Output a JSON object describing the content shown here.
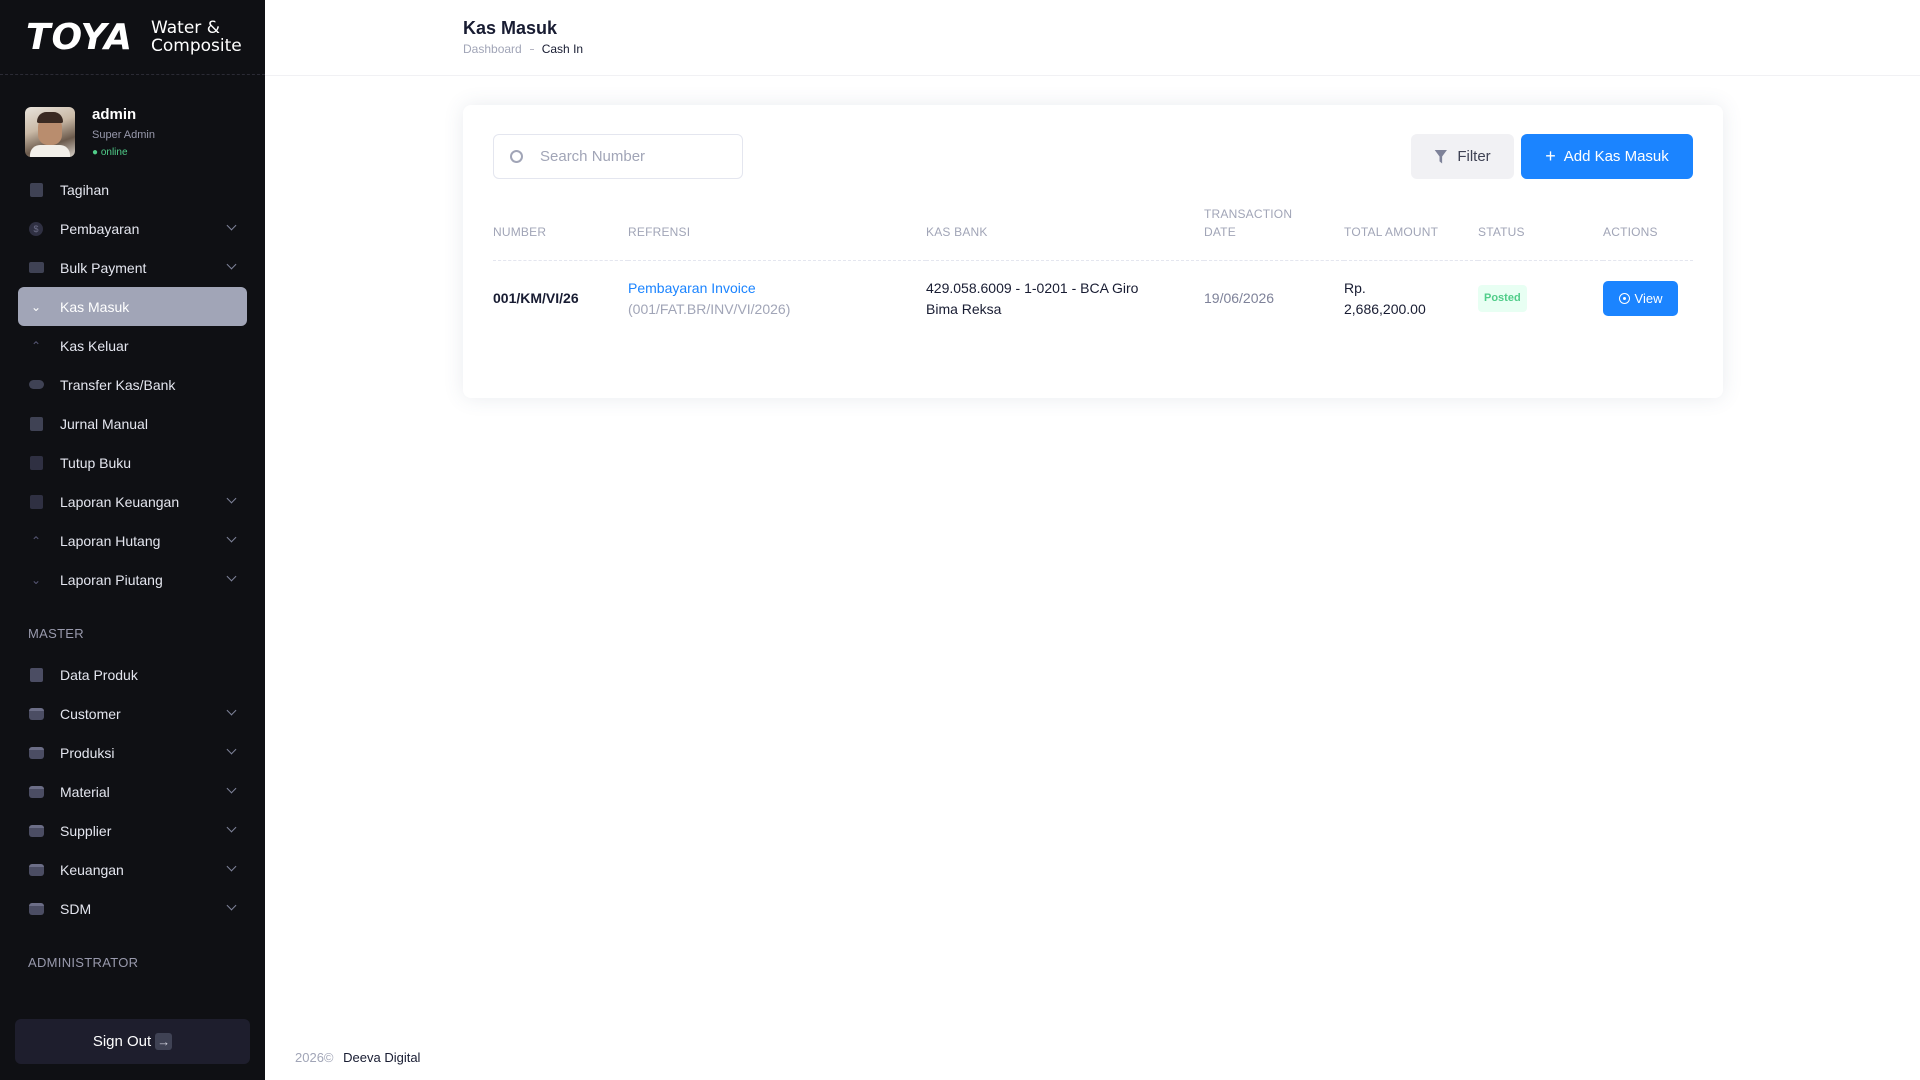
{
  "brand": {
    "logo": "TOYA",
    "sub_line1": "Water &",
    "sub_line2": "Composite"
  },
  "user": {
    "name": "admin",
    "role": "Super Admin",
    "status": "● online"
  },
  "menu": [
    {
      "label": "Tagihan",
      "icon": "document-icon",
      "has_arrow": false
    },
    {
      "label": "Pembayaran",
      "icon": "dollar-icon",
      "has_arrow": true
    },
    {
      "label": "Bulk Payment",
      "icon": "truck-icon",
      "has_arrow": true
    },
    {
      "label": "Kas Masuk",
      "icon": "arrow-down-icon",
      "has_arrow": false,
      "active": true
    },
    {
      "label": "Kas Keluar",
      "icon": "arrow-up-icon",
      "has_arrow": false
    },
    {
      "label": "Transfer Kas/Bank",
      "icon": "toggle-icon",
      "has_arrow": false
    },
    {
      "label": "Jurnal Manual",
      "icon": "journal-icon",
      "has_arrow": false
    },
    {
      "label": "Tutup Buku",
      "icon": "calendar-icon",
      "has_arrow": false
    },
    {
      "label": "Laporan Keuangan",
      "icon": "chart-icon",
      "has_arrow": true
    },
    {
      "label": "Laporan Hutang",
      "icon": "arrow-up-icon",
      "has_arrow": true
    },
    {
      "label": "Laporan Piutang",
      "icon": "arrow-down-icon",
      "has_arrow": true
    }
  ],
  "master_section": "MASTER",
  "master_menu": [
    {
      "label": "Data Produk",
      "icon": "book-icon",
      "has_arrow": false
    },
    {
      "label": "Customer",
      "icon": "box-icon",
      "has_arrow": true
    },
    {
      "label": "Produksi",
      "icon": "box-icon",
      "has_arrow": true
    },
    {
      "label": "Material",
      "icon": "box-icon",
      "has_arrow": true
    },
    {
      "label": "Supplier",
      "icon": "box-icon",
      "has_arrow": true
    },
    {
      "label": "Keuangan",
      "icon": "box-icon",
      "has_arrow": true
    },
    {
      "label": "SDM",
      "icon": "box-icon",
      "has_arrow": true
    }
  ],
  "admin_section": "ADMINISTRATOR",
  "signout": {
    "label": "Sign Out",
    "icon": "→"
  },
  "header": {
    "title": "Kas Masuk",
    "breadcrumb_home": "Dashboard",
    "breadcrumb_current": "Cash In"
  },
  "search": {
    "placeholder": "Search Number",
    "value": ""
  },
  "toolbar": {
    "filter_label": "Filter",
    "add_label": "Add Kas Masuk",
    "add_icon": "+"
  },
  "table": {
    "headers": {
      "number": "NUMBER",
      "ref": "REFRENSI",
      "bank": "KAS BANK",
      "date_line1": "TRANSACTION",
      "date_line2": "DATE",
      "amount": "TOTAL AMOUNT",
      "status": "STATUS",
      "actions": "ACTIONS"
    },
    "rows": [
      {
        "number": "001/KM/VI/26",
        "ref_link": "Pembayaran Invoice",
        "ref_sub": "(001/FAT.BR/INV/VI/2026)",
        "bank_line1": "429.058.6009 - 1-0201 - BCA Giro",
        "bank_line2": "Bima Reksa",
        "date": "19/06/2026",
        "amount_line1": "Rp.",
        "amount_line2": "2,686,200.00",
        "status": "Posted",
        "action": "View"
      }
    ]
  },
  "footer": {
    "year": "2026©",
    "company": "Deeva Digital"
  },
  "colors": {
    "sidebar_bg": "#0f1014",
    "primary": "#1b84ff",
    "active_menu": "#a1a5b7",
    "success": "#50cd89"
  }
}
